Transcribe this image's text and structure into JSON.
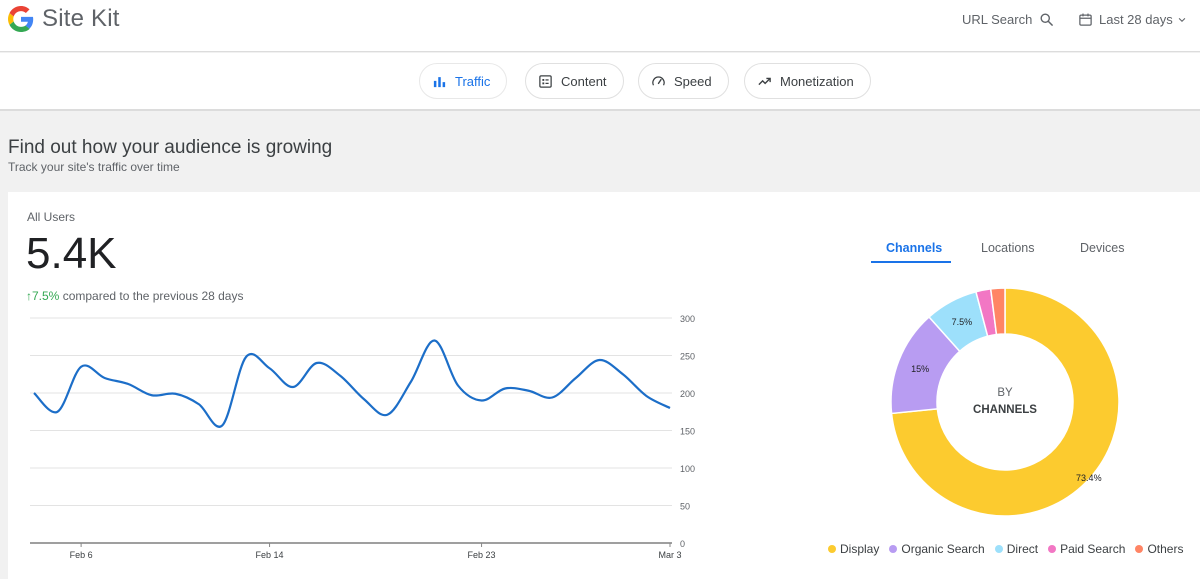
{
  "header": {
    "app_name": "Site Kit",
    "url_search_label": "URL Search",
    "date_range": "Last 28 days"
  },
  "nav": {
    "tabs": [
      {
        "label": "Traffic",
        "icon": "bar-chart-icon",
        "active": true
      },
      {
        "label": "Content",
        "icon": "content-icon",
        "active": false
      },
      {
        "label": "Speed",
        "icon": "speedometer-icon",
        "active": false
      },
      {
        "label": "Monetization",
        "icon": "trending-up-icon",
        "active": false
      }
    ]
  },
  "section": {
    "title": "Find out how your audience is growing",
    "subtitle": "Track your site's traffic over time"
  },
  "overview": {
    "metric_label": "All Users",
    "metric_value": "5.4K",
    "change_arrow": "↑",
    "change_value": "7.5%",
    "change_text": " compared to the previous 28 days"
  },
  "breakdown": {
    "tabs": [
      "Channels",
      "Locations",
      "Devices"
    ],
    "active_tab": "Channels",
    "center_line1": "BY",
    "center_line2": "CHANNELS"
  },
  "colors": {
    "accent": "#1a73e8",
    "line": "#1c6ec8",
    "positive": "#34a853"
  },
  "chart_data": [
    {
      "type": "line",
      "x": [
        "Feb 4",
        "Feb 5",
        "Feb 6",
        "Feb 7",
        "Feb 8",
        "Feb 9",
        "Feb 10",
        "Feb 11",
        "Feb 12",
        "Feb 13",
        "Feb 14",
        "Feb 15",
        "Feb 16",
        "Feb 17",
        "Feb 18",
        "Feb 19",
        "Feb 20",
        "Feb 21",
        "Feb 22",
        "Feb 23",
        "Feb 24",
        "Feb 25",
        "Feb 26",
        "Feb 27",
        "Feb 28",
        "Mar 1",
        "Mar 2",
        "Mar 3"
      ],
      "series": [
        {
          "values": [
            200,
            175,
            235,
            220,
            212,
            197,
            199,
            185,
            157,
            248,
            233,
            208,
            240,
            223,
            192,
            171,
            215,
            270,
            210,
            190,
            206,
            203,
            194,
            220,
            244,
            225,
            196,
            180
          ]
        }
      ],
      "x_tick_labels": [
        "Feb 6",
        "Feb 14",
        "Feb 23",
        "Mar 3"
      ],
      "y_ticks": [
        0,
        50,
        100,
        150,
        200,
        250,
        300
      ],
      "ylim": [
        0,
        300
      ],
      "grid": true
    },
    {
      "type": "pie",
      "donut": true,
      "categories": [
        "Display",
        "Organic Search",
        "Direct",
        "Paid Search",
        "Others"
      ],
      "values": [
        73.4,
        15,
        7.5,
        2.1,
        2.0
      ],
      "value_labels": [
        "73.4%",
        "15%",
        "7.5%",
        "",
        ""
      ],
      "colors": [
        "#fccb2f",
        "#b89cf2",
        "#9de0fb",
        "#f277c4",
        "#ff8565"
      ],
      "legend": "bottom"
    }
  ]
}
